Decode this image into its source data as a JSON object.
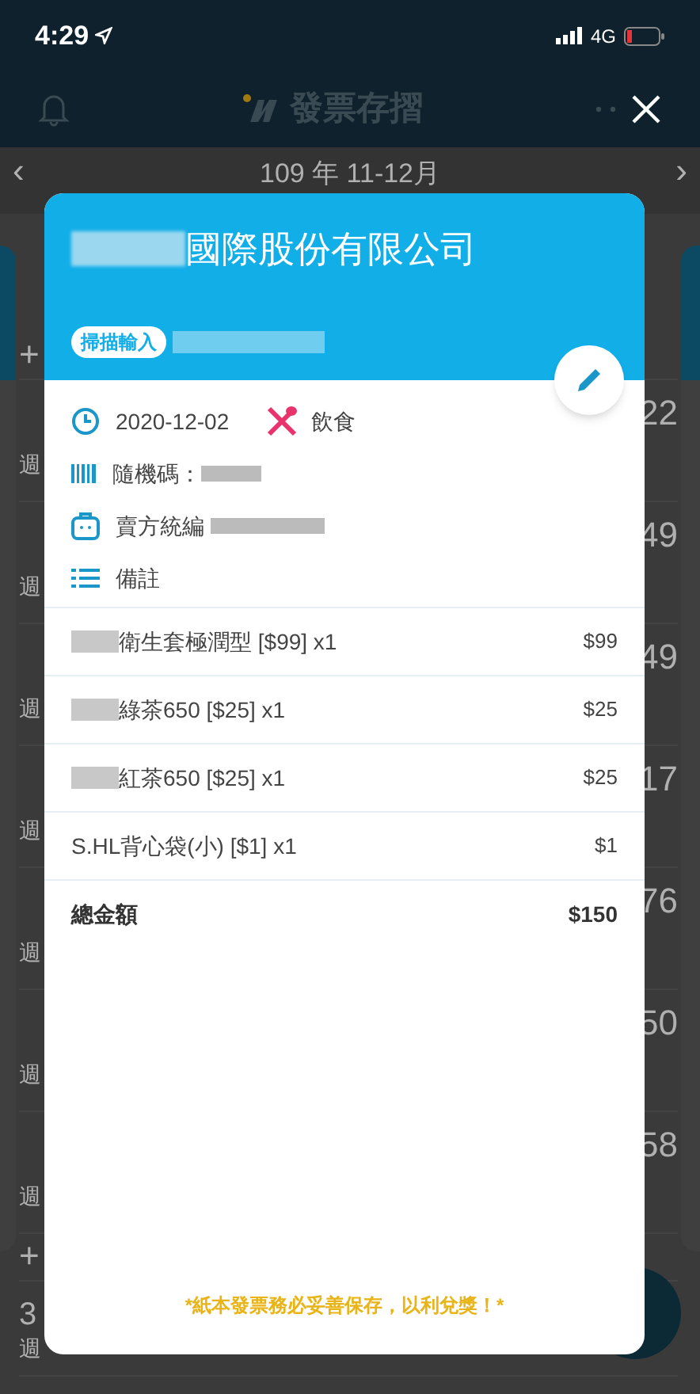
{
  "status_bar": {
    "time": "4:29",
    "network": "4G"
  },
  "header": {
    "title": "發票存摺"
  },
  "period": {
    "label": "109 年 11-12月",
    "prev": "‹",
    "next": "›"
  },
  "background_list": [
    {
      "kind": "add",
      "text": "+"
    },
    {
      "kind": "entry",
      "label": "週",
      "amount": "22"
    },
    {
      "kind": "entry",
      "label": "週",
      "amount": "49"
    },
    {
      "kind": "entry",
      "label": "週",
      "amount": "49"
    },
    {
      "kind": "entry",
      "label": "週",
      "amount": "17"
    },
    {
      "kind": "entry",
      "label": "週",
      "amount": "76"
    },
    {
      "kind": "entry",
      "label": "週",
      "amount": "50"
    },
    {
      "kind": "entry",
      "label": "週",
      "amount": "58"
    },
    {
      "kind": "add",
      "text": "+"
    },
    {
      "kind": "lead",
      "lead": "3",
      "label": "週"
    }
  ],
  "invoice": {
    "seller": "國際股份有限公司",
    "source_badge": "掃描輸入",
    "date": "2020-12-02",
    "category": "飲食",
    "random_code_label": "隨機碼：",
    "seller_id_label": "賣方統編",
    "note_label": "備註",
    "items": [
      {
        "name": "衛生套極潤型 [$99] x1",
        "price": "$99",
        "redacted_prefix": true
      },
      {
        "name": "綠茶650 [$25] x1",
        "price": "$25",
        "redacted_prefix": true
      },
      {
        "name": "紅茶650 [$25] x1",
        "price": "$25",
        "redacted_prefix": true
      },
      {
        "name": "S.HL背心袋(小) [$1] x1",
        "price": "$1",
        "redacted_prefix": false
      }
    ],
    "total_label": "總金額",
    "total": "$150",
    "footer_note": "*紙本發票務必妥善保存，以利兌獎！*"
  }
}
